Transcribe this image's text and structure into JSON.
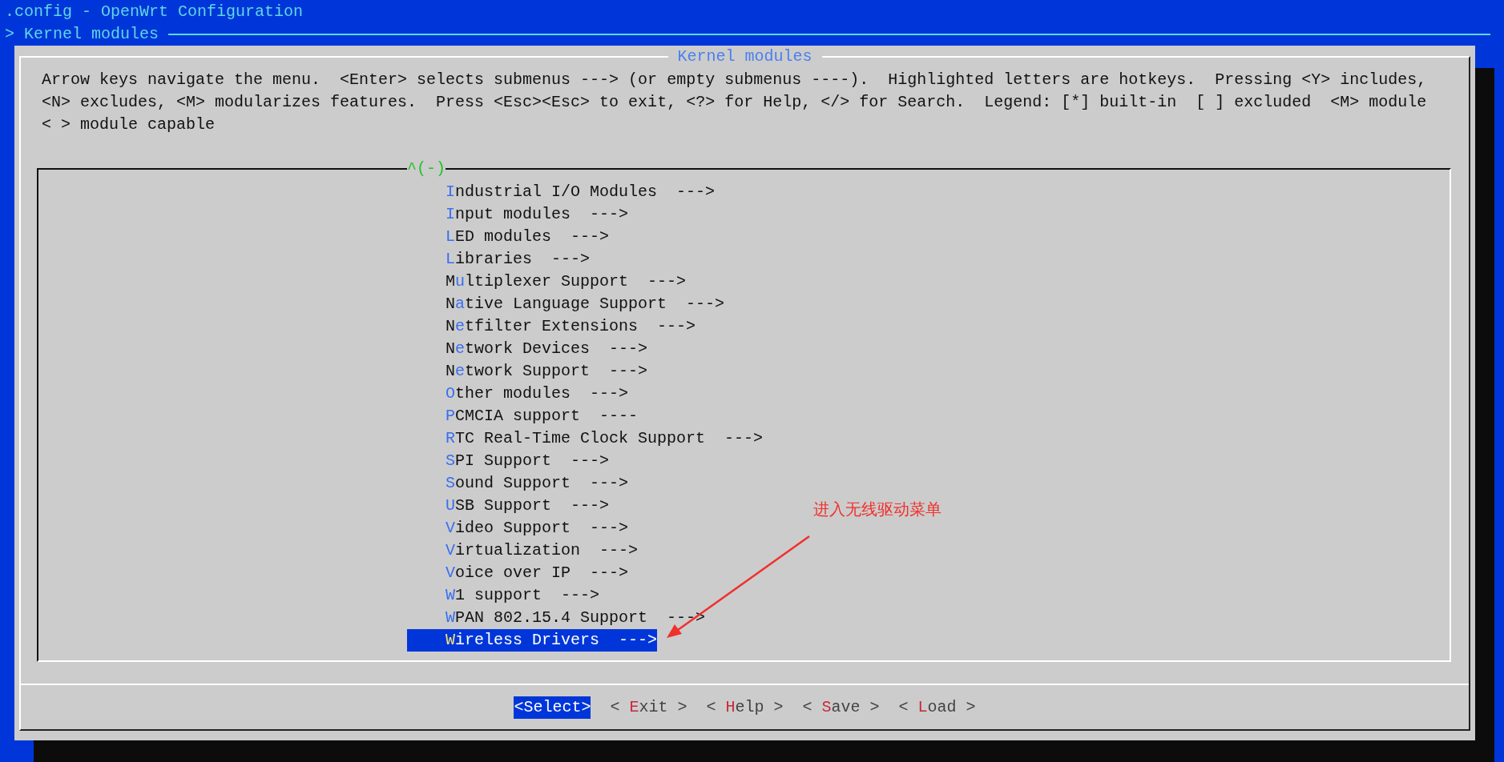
{
  "header": {
    "title": ".config - OpenWrt Configuration",
    "breadcrumb": "> Kernel modules"
  },
  "dialog": {
    "title": "Kernel modules",
    "help_text": "Arrow keys navigate the menu.  <Enter> selects submenus ---> (or empty submenus ----).  Highlighted letters are hotkeys.  Pressing <Y> includes,\n<N> excludes, <M> modularizes features.  Press <Esc><Esc> to exit, <?> for Help, </> for Search.  Legend: [*] built-in  [ ] excluded  <M> module\n< > module capable",
    "scroll_indicator": "^(-)",
    "items": [
      {
        "label": "**I**ndustrial I/O Modules  --->",
        "selected": false
      },
      {
        "label": "**I**nput modules  --->",
        "selected": false
      },
      {
        "label": "**L**ED modules  --->",
        "selected": false
      },
      {
        "label": "**L**ibraries  --->",
        "selected": false
      },
      {
        "label": "M**u**ltiplexer Support  --->",
        "selected": false
      },
      {
        "label": "N**a**tive Language Support  --->",
        "selected": false
      },
      {
        "label": "N**e**tfilter Extensions  --->",
        "selected": false
      },
      {
        "label": "N**e**twork Devices  --->",
        "selected": false
      },
      {
        "label": "N**e**twork Support  --->",
        "selected": false
      },
      {
        "label": "**O**ther modules  --->",
        "selected": false
      },
      {
        "label": "**P**CMCIA support  ----",
        "selected": false
      },
      {
        "label": "**R**TC Real-Time Clock Support  --->",
        "selected": false
      },
      {
        "label": "**S**PI Support  --->",
        "selected": false
      },
      {
        "label": "**S**ound Support  --->",
        "selected": false
      },
      {
        "label": "**U**SB Support  --->",
        "selected": false
      },
      {
        "label": "**V**ideo Support  --->",
        "selected": false
      },
      {
        "label": "**V**irtualization  --->",
        "selected": false
      },
      {
        "label": "**V**oice over IP  --->",
        "selected": false
      },
      {
        "label": "**W**1 support  --->",
        "selected": false
      },
      {
        "label": "**W**PAN 802.15.4 Support  --->",
        "selected": false
      },
      {
        "label": "**W**ireless Drivers  --->",
        "selected": true
      }
    ],
    "buttons": [
      {
        "label": "<Select>",
        "selected": true
      },
      {
        "label": "< **E**xit >",
        "selected": false
      },
      {
        "label": "< **H**elp >",
        "selected": false
      },
      {
        "label": "< **S**ave >",
        "selected": false
      },
      {
        "label": "< **L**oad >",
        "selected": false
      }
    ]
  },
  "annotation": {
    "text": "进入无线驱动菜单"
  }
}
